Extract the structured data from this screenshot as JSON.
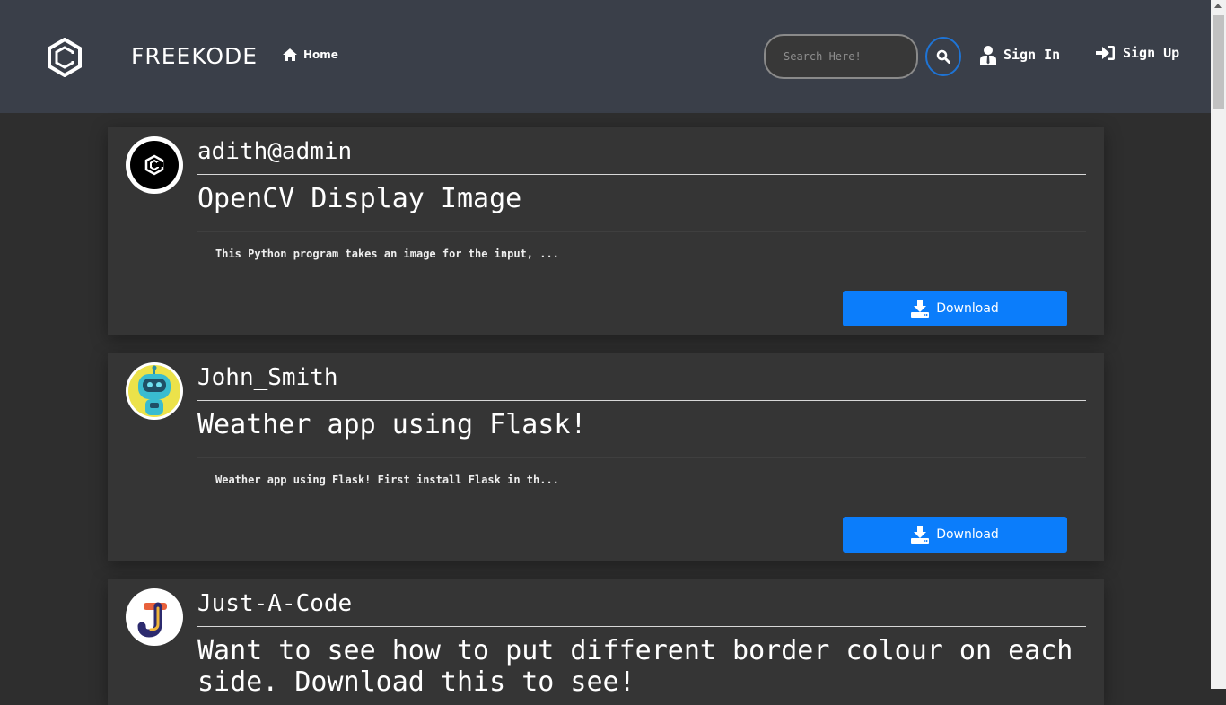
{
  "header": {
    "brand": "FREEKODE",
    "home_label": "Home",
    "search_placeholder": "Search Here!",
    "sign_in_label": "Sign In",
    "sign_up_label": "Sign Up"
  },
  "posts": [
    {
      "username": "adith@admin",
      "title": "OpenCV Display Image",
      "description": "This Python program takes an image for the input, ...",
      "download_label": "Download",
      "avatar_icon": "freekode-logo-icon"
    },
    {
      "username": "John_Smith",
      "title": "Weather app using Flask!",
      "description": "Weather app using Flask! First install Flask in th...",
      "download_label": "Download",
      "avatar_icon": "robot-avatar-icon"
    },
    {
      "username": "Just-A-Code",
      "title": "Want to see how to put different border colour on each side. Download this to see!",
      "title_line1": "Want to see how to put different border colour on each",
      "title_line2": "side. Download this to see!",
      "avatar_icon": "j-letter-avatar-icon"
    }
  ],
  "colors": {
    "navbar": "#3a3f49",
    "background": "#2e2e2e",
    "card": "#353535",
    "accent": "#0b7dfb"
  }
}
